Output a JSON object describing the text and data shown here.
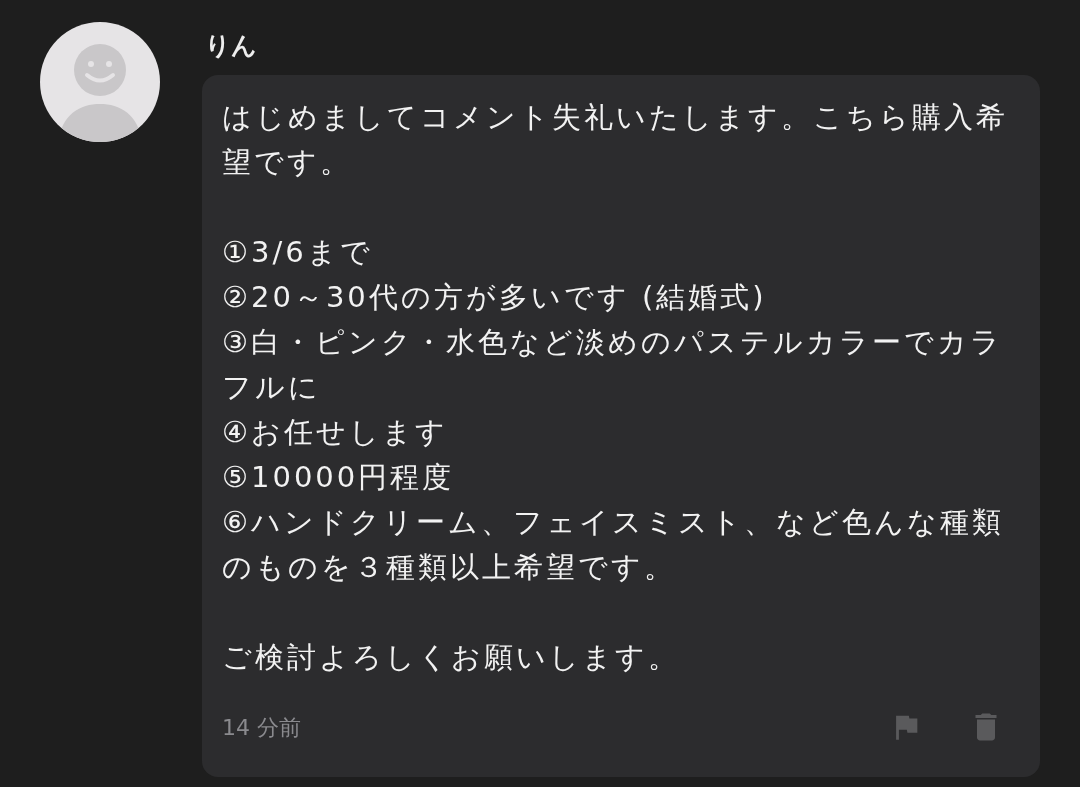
{
  "comment": {
    "author": "りん",
    "paragraphs": [
      {
        "lines": [
          "はじめましてコメント失礼いたします。こちら購入希望です。"
        ]
      },
      {
        "lines": [
          "①3/6まで",
          "②20～30代の方が多いです (結婚式)",
          "③白・ピンク・水色など淡めのパステルカラーでカラフルに",
          "④お任せします",
          "⑤10000円程度",
          "⑥ハンドクリーム、フェイスミスト、など色んな種類のものを３種類以上希望です。"
        ]
      },
      {
        "lines": [
          "ご検討よろしくお願いします。"
        ]
      }
    ],
    "time": "14 分前"
  }
}
